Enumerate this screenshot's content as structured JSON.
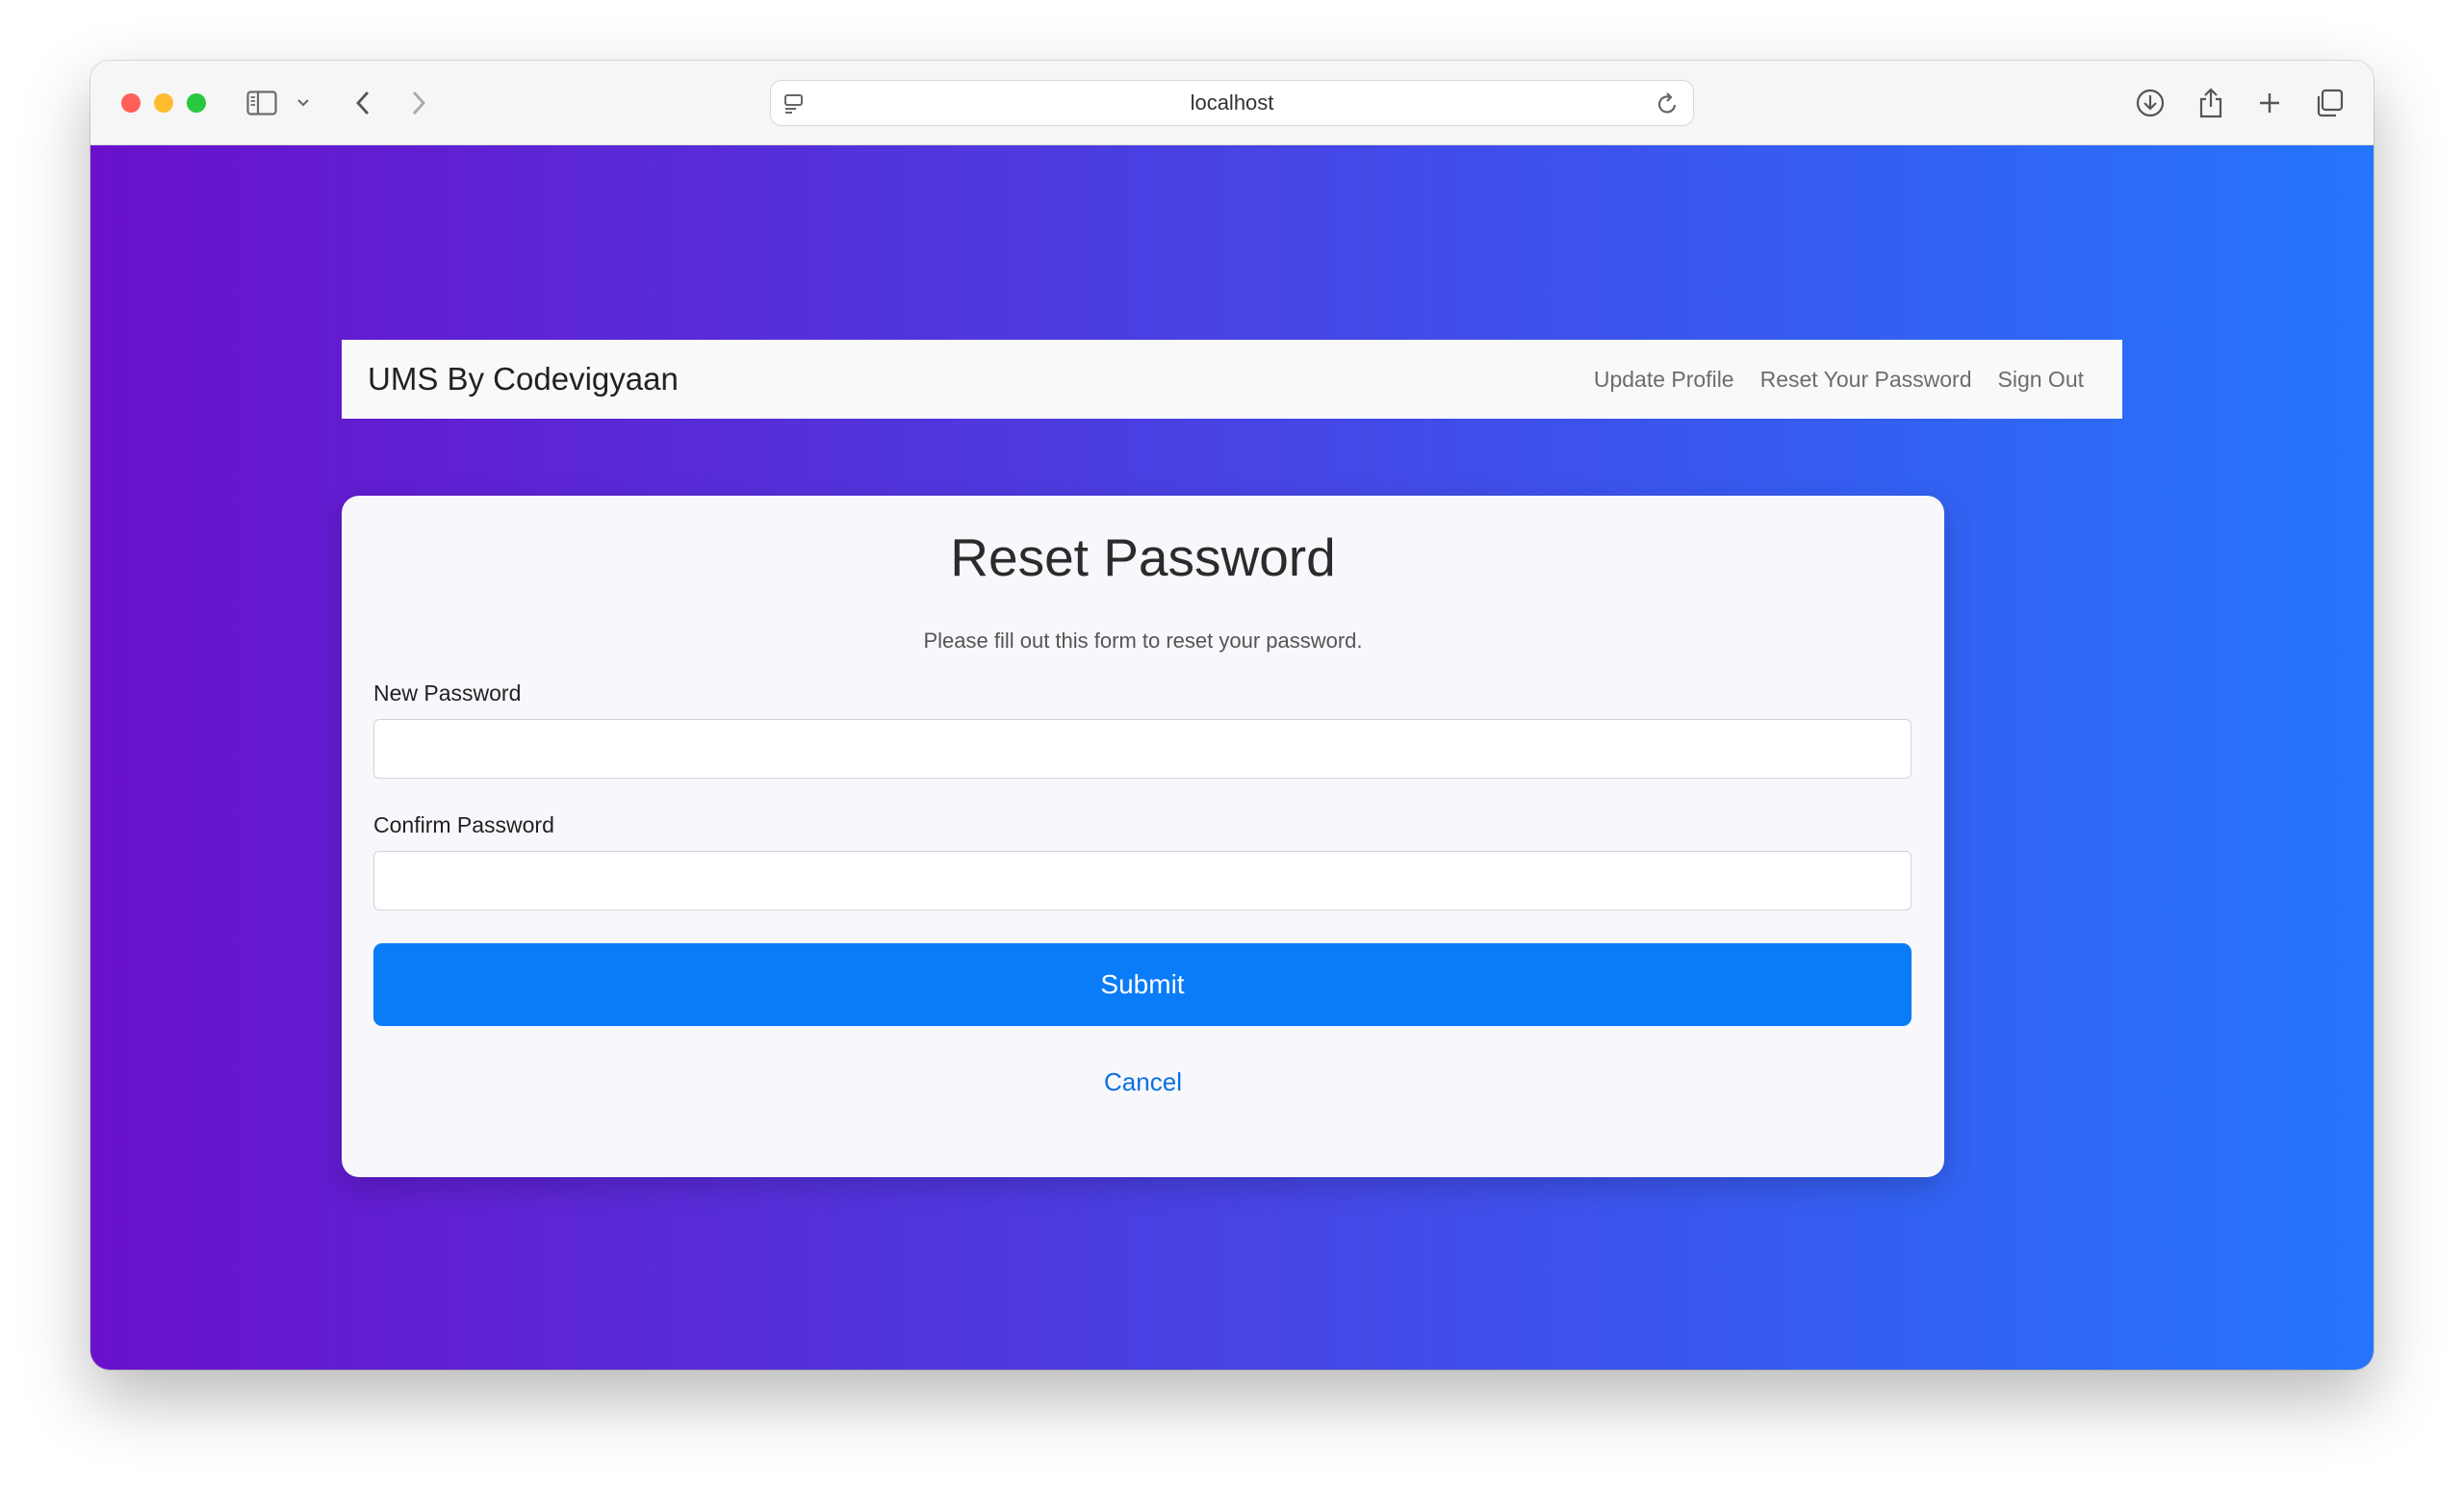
{
  "browser": {
    "url": "localhost",
    "icons": {
      "sidebar": "sidebar-icon",
      "sidebar_menu": "chevron-down-icon",
      "back": "chevron-left-icon",
      "forward": "chevron-right-icon",
      "page_settings": "page-settings-icon",
      "reload": "reload-icon",
      "downloads": "download-icon",
      "share": "share-icon",
      "new_tab": "plus-icon",
      "tab_overview": "tabs-icon"
    }
  },
  "navbar": {
    "brand": "UMS By Codevigyaan",
    "links": [
      "Update Profile",
      "Reset Your Password",
      "Sign Out"
    ]
  },
  "form": {
    "title": "Reset Password",
    "subtitle": "Please fill out this form to reset your password.",
    "new_password_label": "New Password",
    "new_password_value": "",
    "confirm_password_label": "Confirm Password",
    "confirm_password_value": "",
    "submit_label": "Submit",
    "cancel_label": "Cancel"
  },
  "colors": {
    "gradient_start": "#6a11cb",
    "gradient_end": "#2575fc",
    "primary": "#0a7cf8",
    "link": "#0a70e0"
  }
}
